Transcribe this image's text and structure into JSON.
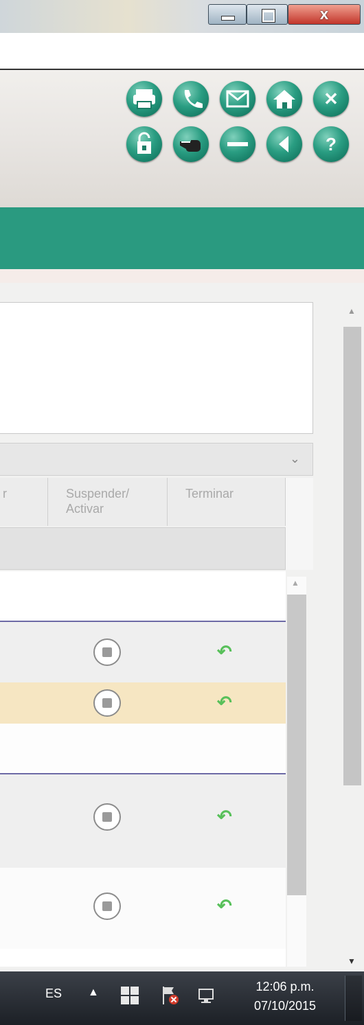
{
  "window": {
    "minimize_icon": "minimize-icon",
    "maximize_icon": "restore-icon",
    "close_label": "x"
  },
  "toolbar": {
    "row1": [
      "print-icon",
      "phone-icon",
      "mail-icon",
      "home-icon",
      "close-icon"
    ],
    "row2": [
      "security-icon",
      "pointer-hand-icon",
      "minus-icon",
      "back-icon",
      "help-icon"
    ],
    "close_glyph": "✕",
    "help_glyph": "?"
  },
  "grid": {
    "columns": [
      {
        "label": "r"
      },
      {
        "label": "Suspender/\nActivar"
      },
      {
        "label": "Terminar"
      }
    ],
    "chevron": "⌄"
  },
  "taskbar": {
    "language": "ES",
    "tray_up": "▲",
    "time": "12:06 p.m.",
    "date": "07/10/2015"
  },
  "colors": {
    "teal": "#2a9a80",
    "selected_row": "#f6e6c2",
    "divider": "#6d6aa6",
    "arrow": "#58c05a"
  }
}
